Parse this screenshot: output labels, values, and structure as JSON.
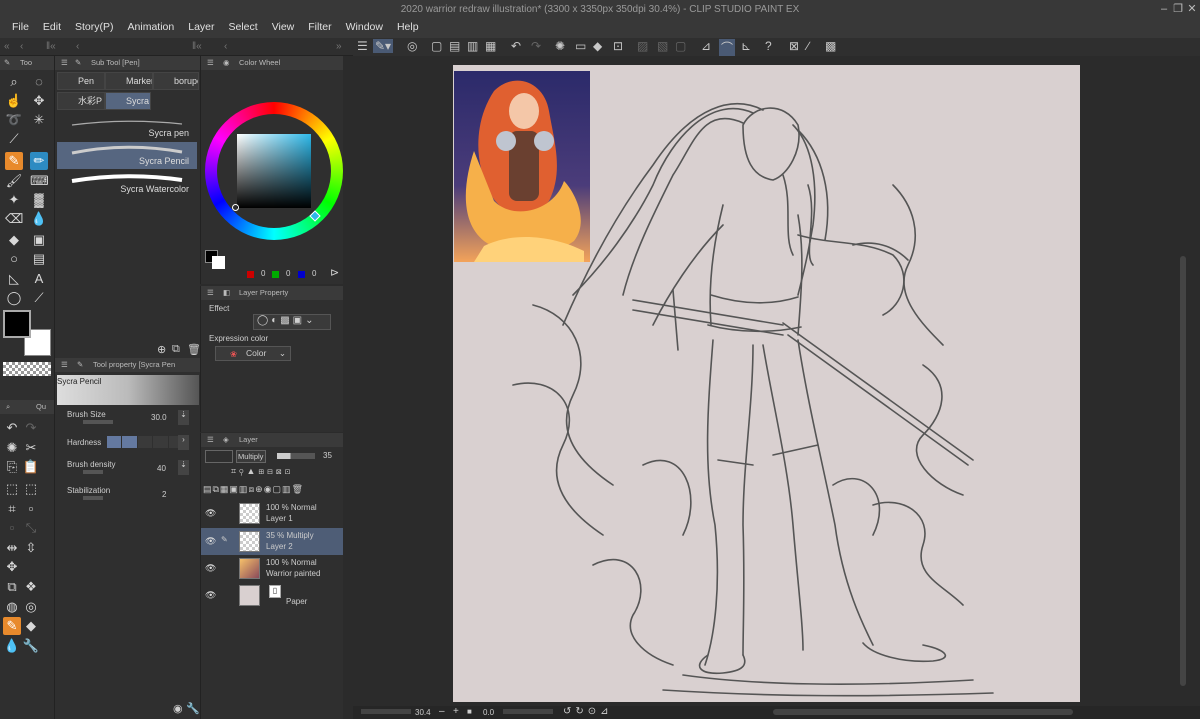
{
  "window": {
    "title": "2020 warrior redraw illustration* (3300 x 3350px 350dpi 30.4%)  - CLIP STUDIO PAINT EX"
  },
  "menu": [
    "File",
    "Edit",
    "Story(P)",
    "Animation",
    "Layer",
    "Select",
    "View",
    "Filter",
    "Window",
    "Help"
  ],
  "panels": {
    "tool_tab": "Too",
    "subtool_title": "Sub Tool [Pen]",
    "subtool_tabs": [
      "Pen",
      "Marker",
      "borupe",
      "水彩P",
      "Sycra"
    ],
    "brushes": [
      "Sycra pen",
      "Sycra Pencil",
      "Sycra Watercolor"
    ],
    "color_wheel_title": "Color Wheel",
    "rgb": [
      "0",
      "0",
      "0"
    ],
    "layer_property_title": "Layer Property",
    "effect_label": "Effect",
    "expression_color_label": "Expression color",
    "expression_color_value": "Color",
    "tool_property_title": "Tool property [Sycra Pen",
    "tool_property_brush": "Sycra Pencil",
    "quick_tab": "Qu",
    "brush_size_label": "Brush Size",
    "brush_size_value": "30.0",
    "hardness_label": "Hardness",
    "brush_density_label": "Brush density",
    "brush_density_value": "40",
    "stabilization_label": "Stabilization",
    "stabilization_value": "2",
    "layer_title": "Layer",
    "blend_mode": "Multiply",
    "opacity": "35"
  },
  "layers": [
    {
      "mode": "100 % Normal",
      "name": "Layer 1"
    },
    {
      "mode": "35 % Multiply",
      "name": "Layer 2"
    },
    {
      "mode": "100 % Normal",
      "name": "Warrior painted"
    },
    {
      "mode": "",
      "name": "Paper"
    }
  ],
  "status": {
    "zoom": "30.4",
    "angle": "0.0"
  },
  "colors": {
    "accent_orange": "#e88a2c",
    "accent_blue": "#2d8bc2",
    "selected_row": "#566680",
    "paper": "#d9d0d0"
  }
}
